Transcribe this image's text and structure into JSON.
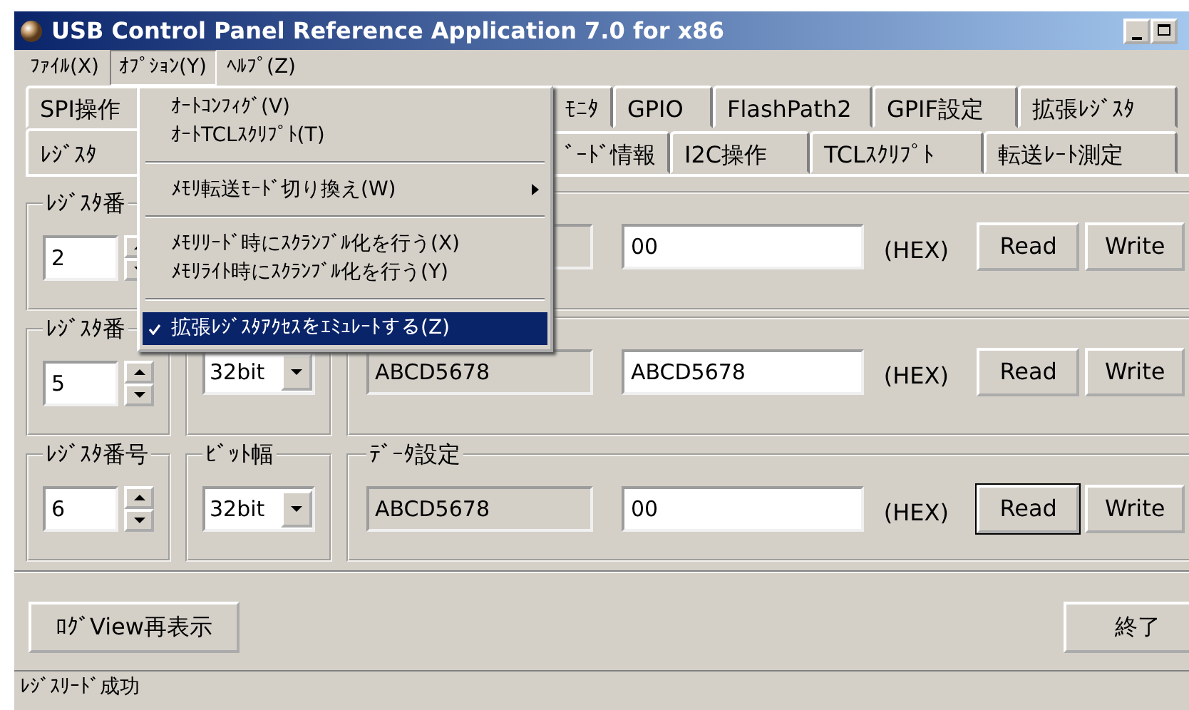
{
  "window": {
    "title": "USB Control Panel Reference Application 7.0 for x86"
  },
  "menu_bar": [
    {
      "label": "ﾌｧｲﾙ(X)",
      "selected": false
    },
    {
      "label": "ｵﾌﾟｼｮﾝ(Y)",
      "selected": true
    },
    {
      "label": "ﾍﾙﾌﾟ(Z)",
      "selected": false
    }
  ],
  "dropdown_menu": {
    "items": [
      {
        "kind": "item",
        "label": "ｵｰﾄｺﾝﾌｨｸﾞ(V)",
        "checked": false,
        "highlighted": false
      },
      {
        "kind": "item",
        "label": "ｵｰﾄTCLｽｸﾘﾌﾟﾄ(T)",
        "checked": false,
        "highlighted": false
      },
      {
        "kind": "separator"
      },
      {
        "kind": "submenu",
        "label": "ﾒﾓﾘ転送ﾓｰﾄﾞ切り換え(W)",
        "checked": false,
        "highlighted": false
      },
      {
        "kind": "separator"
      },
      {
        "kind": "item",
        "label": "ﾒﾓﾘﾘｰﾄﾞ時にｽｸﾗﾝﾌﾞﾙ化を行う(X)",
        "checked": false,
        "highlighted": false
      },
      {
        "kind": "item",
        "label": "ﾒﾓﾘﾗｲﾄ時にｽｸﾗﾝﾌﾞﾙ化を行う(Y)",
        "checked": false,
        "highlighted": false
      },
      {
        "kind": "separator"
      },
      {
        "kind": "item",
        "label": "拡張ﾚｼﾞｽﾀｱｸｾｽをｴﾐｭﾚｰﾄする(Z)",
        "checked": true,
        "highlighted": true
      }
    ]
  },
  "tabs_row_1": [
    {
      "label": "SPI操作",
      "selected": false
    },
    {
      "label": "ﾓﾆﾀ",
      "selected": false
    },
    {
      "label": "GPIO",
      "selected": false
    },
    {
      "label": "FlashPath2",
      "selected": false
    },
    {
      "label": "GPIF設定",
      "selected": false
    },
    {
      "label": "拡張ﾚｼﾞｽﾀ",
      "selected": false
    }
  ],
  "tabs_row_2": [
    {
      "label": "ﾚｼﾞｽﾀ",
      "selected": true
    },
    {
      "label": "ﾞｰﾄﾞ情報",
      "selected": false
    },
    {
      "label": "I2C操作",
      "selected": false
    },
    {
      "label": "TCLｽｸﾘﾌﾟﾄ",
      "selected": false
    },
    {
      "label": "転送ﾚｰﾄ測定",
      "selected": false
    }
  ],
  "register_rows": [
    {
      "register_label": "ﾚｼﾞｽﾀ番",
      "register_number": "2",
      "write_value": "00",
      "unit": "(HEX)",
      "read_button": "Read",
      "write_button": "Write",
      "read_focused": false
    },
    {
      "register_label": "ﾚｼﾞｽﾀ番",
      "register_number": "5",
      "bit_width": "32bit",
      "read_value": "ABCD5678",
      "write_value": "ABCD5678",
      "unit": "(HEX)",
      "read_button": "Read",
      "write_button": "Write",
      "read_focused": false
    },
    {
      "register_label": "ﾚｼﾞｽﾀ番号",
      "register_number": "6",
      "bit_width_label": "ﾋﾞｯﾄ幅",
      "bit_width": "32bit",
      "data_label": "ﾃﾞｰﾀ設定",
      "read_value": "ABCD5678",
      "write_value": "00",
      "unit": "(HEX)",
      "read_button": "Read",
      "write_button": "Write",
      "read_focused": true
    }
  ],
  "buttons": [
    {
      "label": "ﾛｸﾞView再表示"
    },
    {
      "label": "終了"
    }
  ],
  "status_bar": "ﾚｼﾞｽﾘｰﾄﾞ成功"
}
